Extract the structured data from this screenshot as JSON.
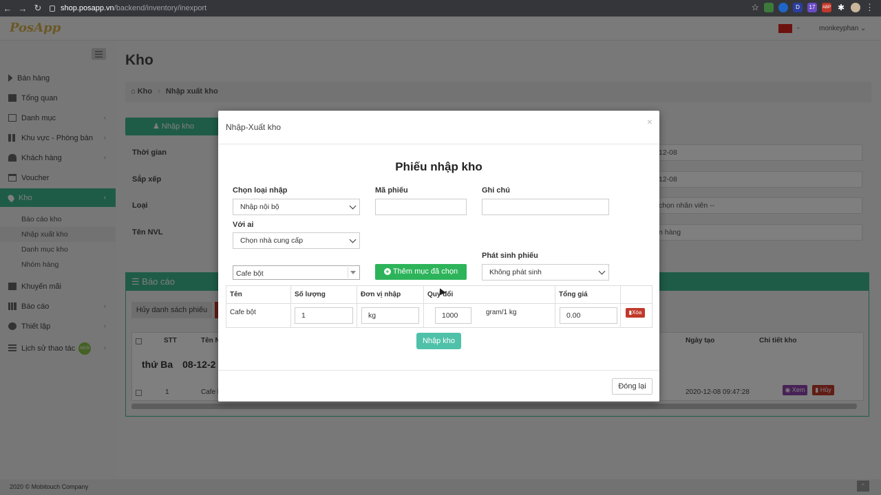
{
  "browser": {
    "url_host": "shop.posapp.vn",
    "url_path": "/backend/inventory/inexport",
    "ext_badge": "17",
    "ext_abp": "ABP",
    "ext_d": "D"
  },
  "app": {
    "logo": "PosApp",
    "user": "monkeyphan",
    "footer": "2020 © Mobitouch Company"
  },
  "sidebar": {
    "items": [
      {
        "label": "Bán hàng"
      },
      {
        "label": "Tổng quan"
      },
      {
        "label": "Danh mục"
      },
      {
        "label": "Khu vực - Phòng bàn"
      },
      {
        "label": "Khách hàng"
      },
      {
        "label": "Voucher"
      },
      {
        "label": "Kho"
      },
      {
        "label": "Khuyến mãi"
      },
      {
        "label": "Báo cáo"
      },
      {
        "label": "Thiết lập"
      },
      {
        "label": "Lịch sử thao tác"
      }
    ],
    "sub_items": [
      {
        "label": "Báo cáo kho"
      },
      {
        "label": "Nhập xuất kho"
      },
      {
        "label": "Danh mục kho"
      },
      {
        "label": "Nhóm hàng"
      }
    ],
    "new_badge": "NEW"
  },
  "page": {
    "title": "Kho",
    "breadcrumb_root": "Kho",
    "breadcrumb_current": "Nhập xuất kho",
    "import_button": "Nhập kho",
    "filters": [
      {
        "label": "Thời gian",
        "value": "12-08"
      },
      {
        "label": "Sắp xếp",
        "value": "12-08"
      },
      {
        "label": "Loại",
        "value": "chọn nhân viên --"
      },
      {
        "label": "Tên NVL",
        "value": "n hàng"
      }
    ],
    "report_title": "Báo cáo",
    "cancel_list_button": "Hủy danh sách phiếu",
    "table_headers": {
      "stt": "STT",
      "name": "Tên N",
      "created": "Ngày tạo",
      "detail": "Chi tiết kho"
    },
    "day_label": "thứ Ba",
    "day_date": "08-12-2",
    "row": {
      "stt": "1",
      "name": "Cafe b",
      "created": "2020-12-08 09:47:28",
      "view": "Xem",
      "cancel": "Hủy"
    }
  },
  "modal": {
    "title": "Nhập-Xuất kho",
    "close_glyph": "×",
    "form_title": "Phiếu nhập kho",
    "type_label": "Chọn loại nhập",
    "type_value": "Nhập nội bộ",
    "code_label": "Mã phiếu",
    "code_value": "",
    "note_label": "Ghi chú",
    "note_value": "",
    "partner_label": "Với ai",
    "partner_value": "Chọn nhà cung cấp",
    "generate_label": "Phát sinh phiếu",
    "generate_value": "Không phát sinh",
    "material_value": "Cafe bột",
    "add_button": "Thêm mục đã chọn",
    "table": {
      "headers": {
        "name": "Tên",
        "qty": "Số lượng",
        "unit": "Đơn vị nhập",
        "convert": "Quy đổi",
        "total": "Tổng giá"
      },
      "row": {
        "name": "Cafe bột",
        "qty": "1",
        "unit": "kg",
        "convert": "1000",
        "convert_unit": "gram/1 kg",
        "total": "0.00",
        "delete": "Xóa"
      }
    },
    "submit_button": "Nhập kho",
    "close_button": "Đóng lại"
  }
}
